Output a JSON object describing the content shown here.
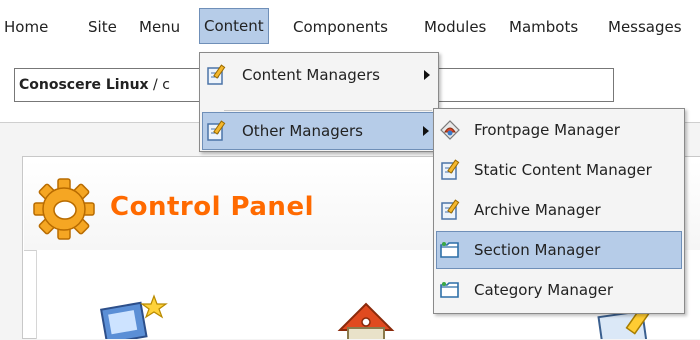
{
  "menubar": {
    "items": [
      {
        "label": "Home"
      },
      {
        "label": "Site"
      },
      {
        "label": "Menu"
      },
      {
        "label": "Content"
      },
      {
        "label": "Components"
      },
      {
        "label": "Modules"
      },
      {
        "label": "Mambots"
      },
      {
        "label": "Messages"
      }
    ],
    "active": "Content"
  },
  "pathbar": {
    "site": "Conoscere Linux",
    "sep": " / ",
    "partial": "c"
  },
  "panel": {
    "title": "Control Panel",
    "title_color": "#ff6a00"
  },
  "content_menu": {
    "items": [
      {
        "label": "Content Managers",
        "icon": "edit-icon",
        "has_submenu": true
      },
      {
        "label": "Other Managers",
        "icon": "edit-icon",
        "has_submenu": true,
        "highlighted": true
      }
    ]
  },
  "submenu": {
    "items": [
      {
        "label": "Frontpage Manager",
        "icon": "frontpage-icon"
      },
      {
        "label": "Static Content Manager",
        "icon": "edit-icon"
      },
      {
        "label": "Archive Manager",
        "icon": "edit-icon"
      },
      {
        "label": "Section Manager",
        "icon": "folder-icon",
        "highlighted": true
      },
      {
        "label": "Category Manager",
        "icon": "folder-icon"
      }
    ]
  },
  "colors": {
    "highlight": "#b6cce8",
    "highlight_border": "#6f8fb8"
  }
}
